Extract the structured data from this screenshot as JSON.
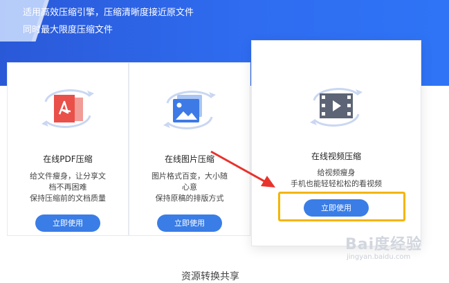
{
  "banner": {
    "line1": "适用高效压缩引擎，压缩清晰度接近原文件",
    "line2": "同时最大限度压缩文件"
  },
  "cards": {
    "pdf": {
      "title": "在线PDF压缩",
      "desc": [
        "给文件瘦身，让分享文",
        "档不再困难",
        "保持压缩前的文档质量"
      ],
      "button": "立即使用",
      "icon": "pdf-compress-icon"
    },
    "image": {
      "title": "在线图片压缩",
      "desc": [
        "图片格式百变，大小随",
        "心意",
        "保持原稿的排版方式"
      ],
      "button": "立即使用",
      "icon": "image-compress-icon"
    },
    "video": {
      "title": "在线视频压缩",
      "desc": [
        "给视频瘦身",
        "手机也能轻轻松松的看视频"
      ],
      "button": "立即使用",
      "icon": "video-compress-icon"
    }
  },
  "watermark": {
    "main": "Bai度经验",
    "sub": "jingyan.baidu.com"
  },
  "bottom": {
    "text": "资源转换共享"
  },
  "colors": {
    "banner": "#2f6cf0",
    "button": "#3a7de6",
    "highlight": "#f4b500",
    "arrow": "#e8322c",
    "pdf_red": "#e9504a",
    "image_blue": "#3d7ae6",
    "video_gray": "#5c6475"
  }
}
